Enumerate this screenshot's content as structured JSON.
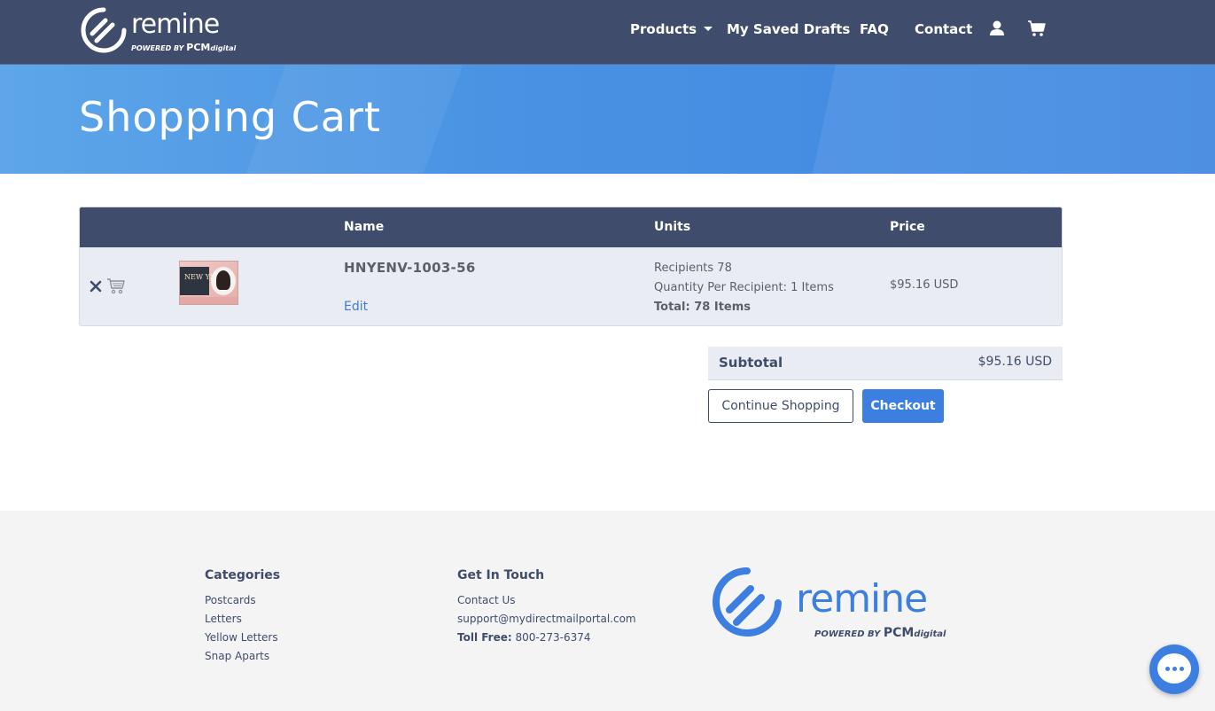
{
  "brand": {
    "logo_text": "remine",
    "powered_by": "POWERED BY",
    "pcm": "PCM",
    "digital": "digital"
  },
  "nav": {
    "products": "Products",
    "saved_drafts": "My Saved Drafts",
    "faq": "FAQ",
    "contact": "Contact",
    "user_icon": "user-icon",
    "cart_icon": "cart-icon"
  },
  "hero": {
    "title": "Shopping Cart"
  },
  "cart": {
    "columns": [
      "Name",
      "Units",
      "Price"
    ],
    "items": [
      {
        "name": "HNYENV-1003-56",
        "edit_label": "Edit",
        "thumbnail_text": "NEW YEAR",
        "recipients": "Recipients 78",
        "quantity": "Quantity Per Recipient: 1 Items",
        "total": "Total: 78 Items",
        "price": "$95.16 USD"
      }
    ]
  },
  "summary": {
    "subtotal_label": "Subtotal",
    "subtotal_value": "$95.16 USD",
    "continue_label": "Continue Shopping",
    "checkout_label": "Checkout"
  },
  "footer": {
    "categories_heading": "Categories",
    "categories": [
      "Postcards",
      "Letters",
      "Yellow Letters",
      "Snap Aparts"
    ],
    "contact_heading": "Get In Touch",
    "contact_us": "Contact Us",
    "email": "support@mydirectmailportal.com",
    "toll_free_label": "Toll Free:",
    "toll_free_number": "800-273-6374"
  },
  "colors": {
    "navbar": "#3f4c6b",
    "accent": "#3c7fe0",
    "hero": "#4a93e3"
  }
}
